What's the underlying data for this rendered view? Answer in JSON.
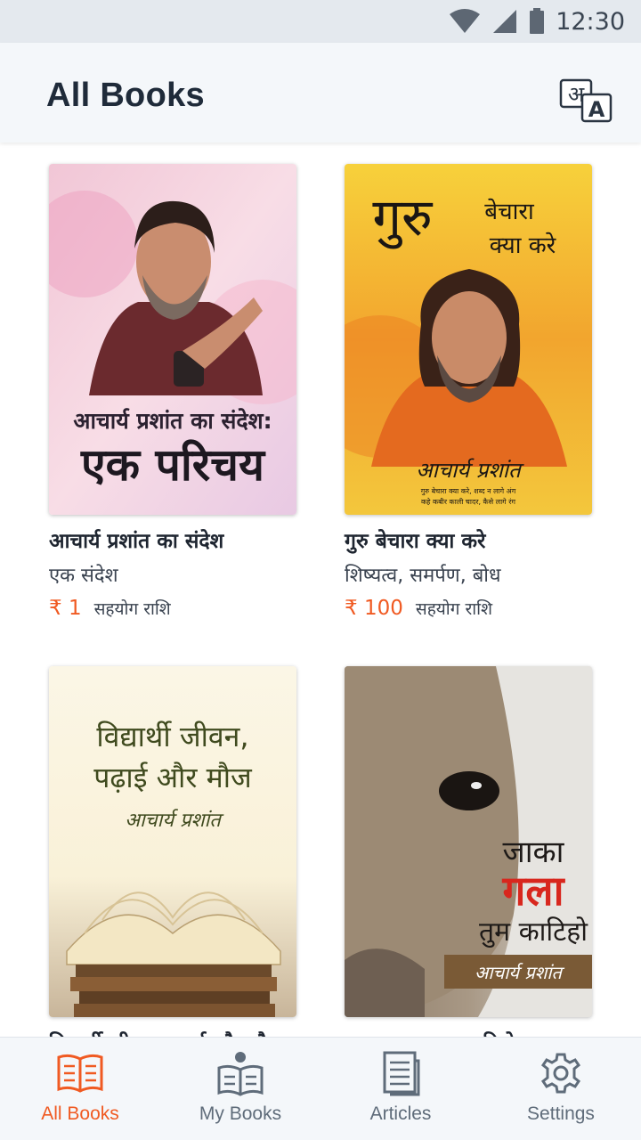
{
  "status_bar": {
    "time": "12:30"
  },
  "header": {
    "title": "All Books",
    "translate_icon": "translate-icon"
  },
  "books": [
    {
      "title": "आचार्य प्रशांत का संदेश",
      "subtitle": "एक संदेश",
      "price": "₹ 1",
      "price_label": "सहयोग राशि",
      "cover_text_1": "आचार्य प्रशांत का संदेश:",
      "cover_text_2": "एक परिचय"
    },
    {
      "title": "गुरु बेचारा क्या करे",
      "subtitle": "शिष्यत्व, समर्पण, बोध",
      "price": "₹ 100",
      "price_label": "सहयोग राशि",
      "cover_text_1": "गुरु",
      "cover_text_2": "बेचारा",
      "cover_text_3": "क्या करे",
      "cover_author": "आचार्य प्रशांत",
      "cover_quote_1": "गुरु बेचारा क्या करे, शब्द न लागे अंग",
      "cover_quote_2": "कहे कबीर काली चादर, कैसे लागे रंग"
    },
    {
      "title": "विद्यार्थी जीवन, पढ़ाई और मौज",
      "cover_text_1": "विद्यार्थी जीवन,",
      "cover_text_2": "पढ़ाई और मौज",
      "cover_author": "आचार्य प्रशांत"
    },
    {
      "title": "जाका गला तुम काटिहो",
      "cover_text_1": "जाका",
      "cover_text_2": "गला",
      "cover_text_3": "तुम काटिहो",
      "cover_author": "आचार्य प्रशांत"
    }
  ],
  "bottom_nav": [
    {
      "label": "All Books",
      "icon": "open-book-icon",
      "active": true
    },
    {
      "label": "My Books",
      "icon": "reader-icon",
      "active": false
    },
    {
      "label": "Articles",
      "icon": "article-icon",
      "active": false
    },
    {
      "label": "Settings",
      "icon": "gear-icon",
      "active": false
    }
  ],
  "colors": {
    "accent": "#f05a22",
    "nav_inactive": "#5f6c7a",
    "title": "#1f2b3a"
  }
}
